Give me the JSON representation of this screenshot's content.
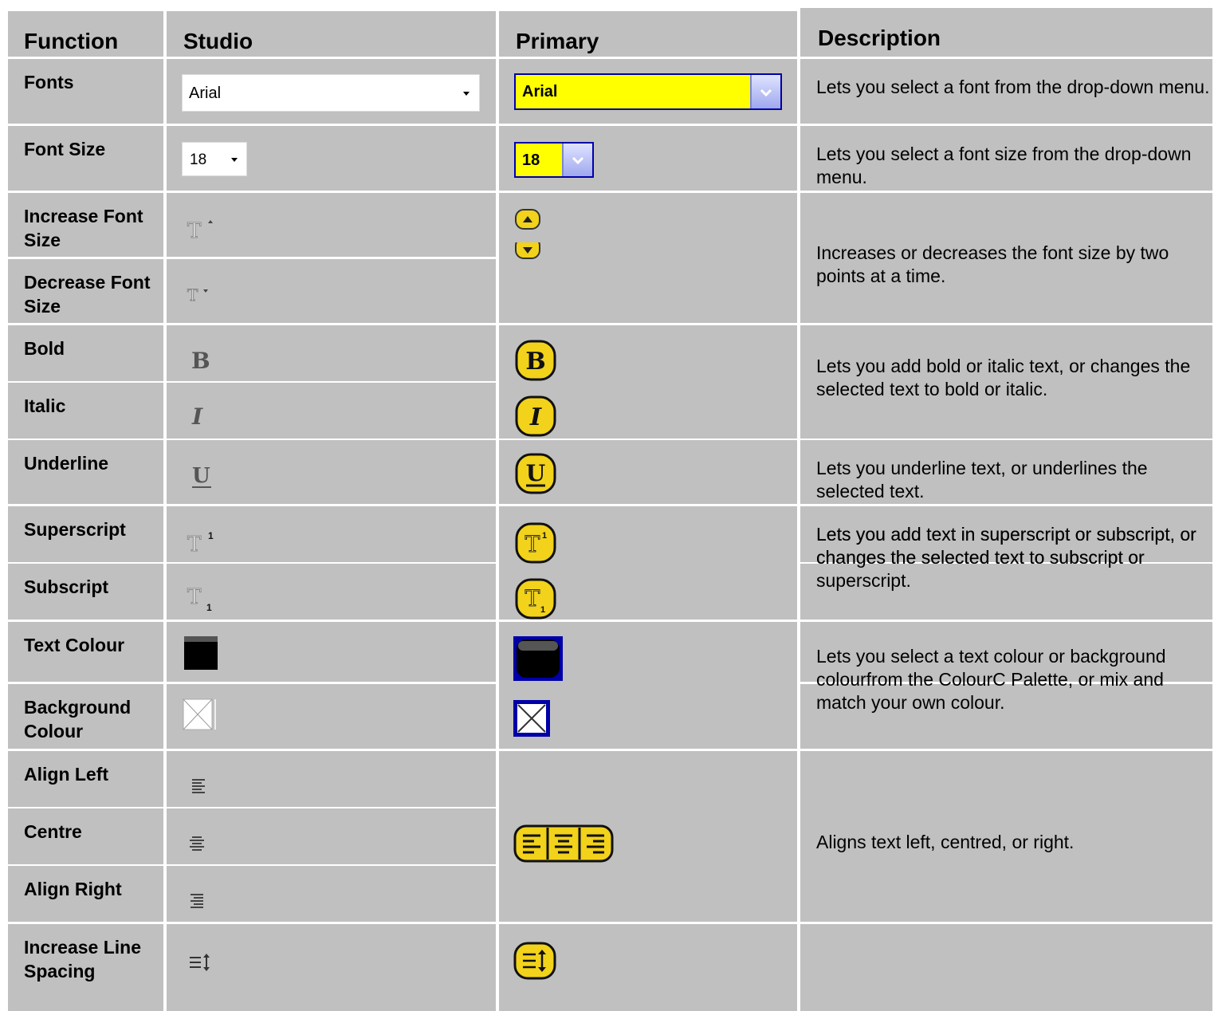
{
  "headers": {
    "function": "Function",
    "studio": "Studio",
    "primary": "Primary",
    "description": "Description"
  },
  "rows": {
    "fonts": {
      "label": "Fonts",
      "studio_value": "Arial",
      "primary_value": "Arial",
      "description": "Lets you select a font from the drop-down menu."
    },
    "font_size": {
      "label": "Font Size",
      "studio_value": "18",
      "primary_value": "18",
      "description": "Lets you select a font size from the drop-down menu."
    },
    "increase_font_size": {
      "label": "Increase Font Size"
    },
    "decrease_font_size": {
      "label": "Decrease Font Size"
    },
    "font_size_step_description": "Increases or decreases the font size by two points at a time.",
    "bold": {
      "label": "Bold"
    },
    "italic": {
      "label": "Italic"
    },
    "bold_italic_description": "Lets you add bold or italic text, or changes the selected text to bold or italic.",
    "underline": {
      "label": "Underline",
      "description": "Lets you underline text, or underlines the selected text."
    },
    "superscript": {
      "label": "Superscript"
    },
    "subscript": {
      "label": "Subscript"
    },
    "script_description": "Lets you add text in superscript or subscript, or changes the selected text to subscript or superscript.",
    "text_colour": {
      "label": "Text Colour"
    },
    "background_colour": {
      "label": "Background Colour"
    },
    "colour_description": "Lets you select a text colour or background colourfrom the ColourC Palette, or mix and match your own colour.",
    "align_left": {
      "label": "Align Left"
    },
    "centre": {
      "label": "Centre"
    },
    "align_right": {
      "label": "Align Right"
    },
    "align_description": "Aligns text left, centred, or right.",
    "increase_line_spacing": {
      "label": "Increase Line Spacing"
    }
  },
  "icons": {
    "studio_dropdown": "chevron-down-icon",
    "primary_dropdown": "chevron-down-icon",
    "increase_font": "text-increase-icon",
    "decrease_font": "text-decrease-icon",
    "bold": "bold-icon",
    "italic": "italic-icon",
    "underline": "underline-icon",
    "superscript": "superscript-icon",
    "subscript": "subscript-icon",
    "text_colour": "text-colour-icon",
    "background_colour": "background-colour-icon",
    "align_left": "align-left-icon",
    "align_centre": "align-centre-icon",
    "align_right": "align-right-icon",
    "line_spacing": "line-spacing-icon"
  },
  "colors": {
    "cell_bg": "#c0c0c0",
    "primary_yellow": "#ffff00",
    "primary_button_gold": "#f2d21a",
    "primary_border": "#0000a8"
  }
}
